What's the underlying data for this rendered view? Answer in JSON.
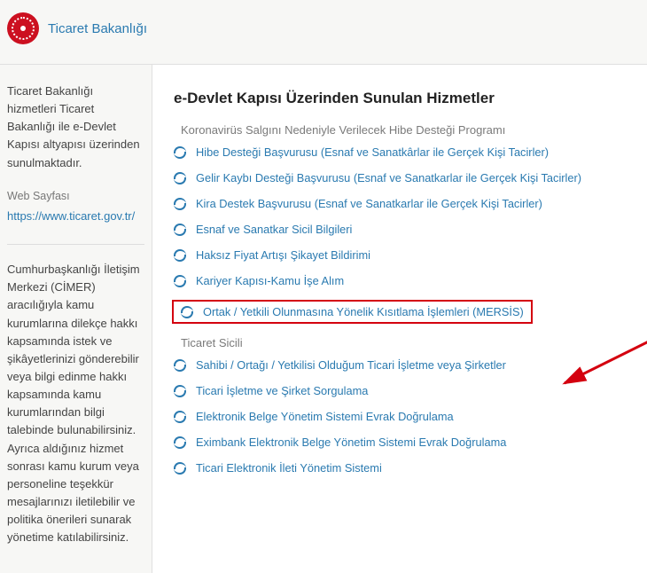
{
  "header": {
    "title": "Ticaret Bakanlığı"
  },
  "sidebar": {
    "intro": "Ticaret Bakanlığı hizmetleri Ticaret Bakanlığı ile e-Devlet Kapısı altyapısı üzerinden sunulmaktadır.",
    "web_label": "Web Sayfası",
    "web_url": "https://www.ticaret.gov.tr/",
    "cimer": "Cumhurbaşkanlığı İletişim Merkezi (CİMER) aracılığıyla kamu kurumlarına dilekçe hakkı kapsamında istek ve şikâyetlerinizi gönderebilir veya bilgi edinme hakkı kapsamında kamu kurumlarından bilgi talebinde bulunabilirsiniz. Ayrıca aldığınız hizmet sonrası kamu kurum veya personeline teşekkür mesajlarınızı iletilebilir ve politika önerileri sunarak yönetime katılabilirsiniz."
  },
  "main": {
    "title": "e-Devlet Kapısı Üzerinden Sunulan Hizmetler",
    "groups": [
      {
        "title": "Koronavirüs Salgını Nedeniyle Verilecek Hibe Desteği Programı",
        "indent": "indent1",
        "items": [
          {
            "text": "Hibe Desteği Başvurusu (Esnaf ve Sanatkârlar ile Gerçek Kişi Tacirler)",
            "indent": "indent2"
          },
          {
            "text": "Gelir Kaybı Desteği Başvurusu (Esnaf ve Sanatkarlar ile Gerçek Kişi Tacirler)",
            "indent": "indent2"
          },
          {
            "text": "Kira Destek Başvurusu (Esnaf ve Sanatkarlar ile Gerçek Kişi Tacirler)",
            "indent": "indent2"
          },
          {
            "text": "Esnaf ve Sanatkar Sicil Bilgileri",
            "indent": "indent1"
          },
          {
            "text": "Haksız Fiyat Artışı Şikayet Bildirimi",
            "indent": "indent1"
          },
          {
            "text": "Kariyer Kapısı-Kamu İşe Alım",
            "indent": "indent1"
          },
          {
            "text": "Ortak / Yetkili Olunmasına Yönelik Kısıtlama İşlemleri (MERSİS)",
            "indent": "indent1",
            "highlight": true
          }
        ]
      },
      {
        "title": "Ticaret Sicili",
        "indent": "indent1",
        "items": [
          {
            "text": "Sahibi / Ortağı / Yetkilisi Olduğum Ticari İşletme veya Şirketler",
            "indent": "indent2"
          },
          {
            "text": "Ticari İşletme ve Şirket Sorgulama",
            "indent": "indent2"
          },
          {
            "text": "Elektronik Belge Yönetim Sistemi Evrak Doğrulama",
            "indent": "indent1"
          },
          {
            "text": "Eximbank Elektronik Belge Yönetim Sistemi Evrak Doğrulama",
            "indent": "indent1"
          },
          {
            "text": "Ticari Elektronik İleti Yönetim Sistemi",
            "indent": "indent1"
          }
        ]
      }
    ]
  }
}
